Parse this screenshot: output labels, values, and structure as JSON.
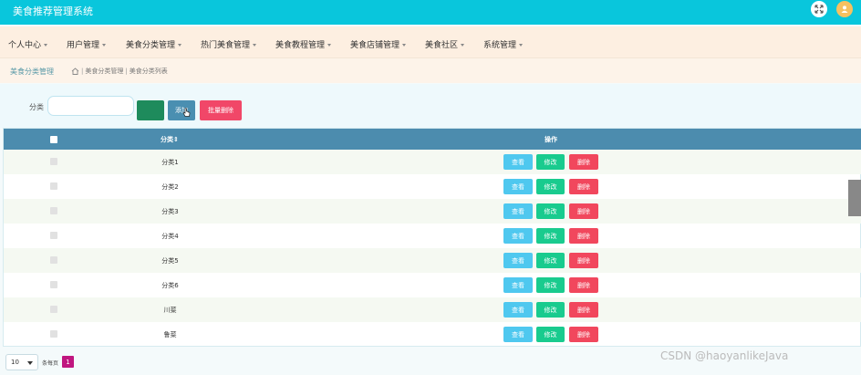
{
  "app": {
    "title": "美食推荐管理系统"
  },
  "nav": {
    "items": [
      {
        "label": "个人中心"
      },
      {
        "label": "用户管理"
      },
      {
        "label": "美食分类管理"
      },
      {
        "label": "热门美食管理"
      },
      {
        "label": "美食教程管理"
      },
      {
        "label": "美食店铺管理"
      },
      {
        "label": "美食社区"
      },
      {
        "label": "系统管理"
      }
    ]
  },
  "breadcrumb": {
    "title": "美食分类管理",
    "path": [
      "美食分类管理",
      "美食分类列表"
    ]
  },
  "search": {
    "label": "分类",
    "value": "",
    "add_label": "添加",
    "batch_delete_label": "批量删除"
  },
  "table": {
    "headers": {
      "name": "分类⇕",
      "actions": "操作"
    },
    "rows": [
      {
        "name": "分类1"
      },
      {
        "name": "分类2"
      },
      {
        "name": "分类3"
      },
      {
        "name": "分类4"
      },
      {
        "name": "分类5"
      },
      {
        "name": "分类6"
      },
      {
        "name": "川菜"
      },
      {
        "name": "鲁菜"
      }
    ],
    "actions": {
      "view": "查看",
      "edit": "修改",
      "delete": "删除"
    }
  },
  "pagination": {
    "page_size": "10",
    "per_page_label": "条每页",
    "current_page": "1"
  },
  "watermark": "CSDN @haoyanlikeJava",
  "colors": {
    "topbar": "#09c6dc",
    "nav_bg": "#fdefe1",
    "table_header": "#4c8cae",
    "view_btn": "#4fc8ef",
    "edit_btn": "#19cb8e",
    "delete_btn": "#f1475d",
    "page_active": "#c0167f"
  }
}
